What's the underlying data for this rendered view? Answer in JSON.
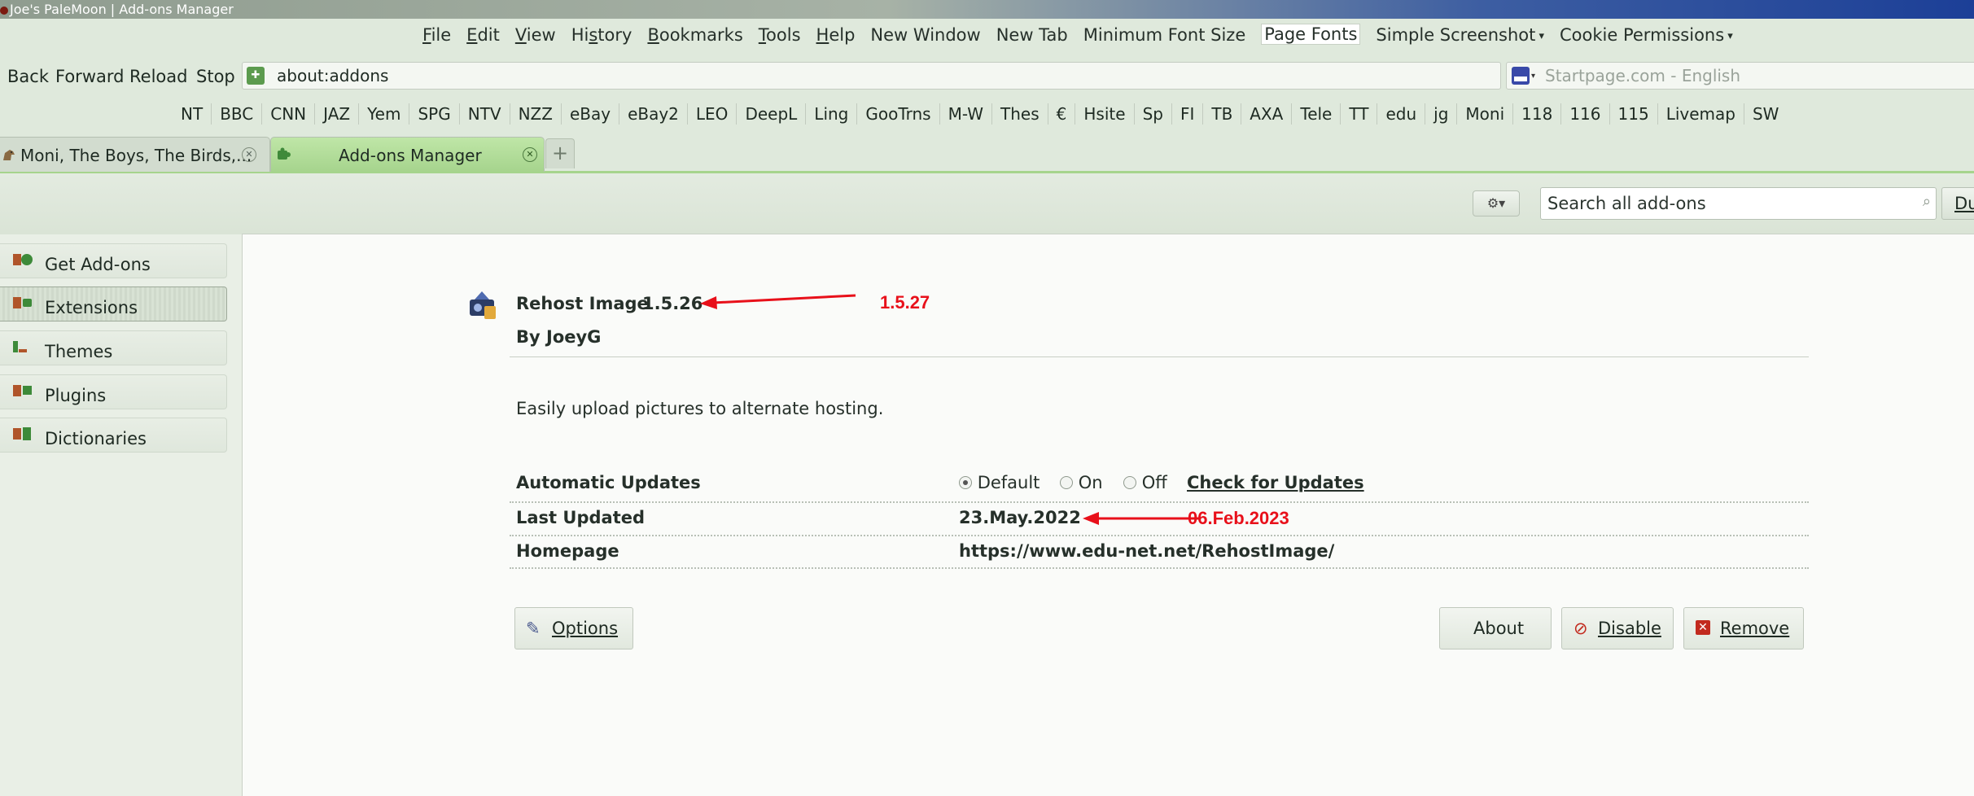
{
  "window": {
    "title": "Joe's PaleMoon | Add-ons Manager"
  },
  "menubar": {
    "items": [
      "File",
      "Edit",
      "View",
      "History",
      "Bookmarks",
      "Tools",
      "Help",
      "New Window",
      "New Tab",
      "Minimum Font Size",
      "Page Fonts",
      "Simple Screenshot",
      "Cookie Permissions"
    ]
  },
  "navbar": {
    "back": "Back",
    "forward": "Forward",
    "reload": "Reload",
    "stop": "Stop",
    "url": "about:addons",
    "search_placeholder": "Startpage.com - English"
  },
  "bookmarks": [
    "NT",
    "BBC",
    "CNN",
    "JAZ",
    "Yem",
    "SPG",
    "NTV",
    "NZZ",
    "eBay",
    "eBay2",
    "LEO",
    "DeepL",
    "Ling",
    "GooTrns",
    "M-W",
    "Thes",
    "€",
    "Hsite",
    "Sp",
    "FI",
    "TB",
    "AXA",
    "Tele",
    "TT",
    "edu",
    "jg",
    "Moni",
    "118",
    "116",
    "115",
    "Livemap",
    "SW"
  ],
  "tabs": [
    {
      "label": "Moni, The Boys, The Birds,..."
    },
    {
      "label": "Add-ons Manager"
    }
  ],
  "addons_toolbar": {
    "search_placeholder": "Search all add-ons",
    "cut_button": "Du"
  },
  "sidebar": {
    "items": [
      {
        "label": "Get Add-ons"
      },
      {
        "label": "Extensions"
      },
      {
        "label": "Themes"
      },
      {
        "label": "Plugins"
      },
      {
        "label": "Dictionaries"
      }
    ]
  },
  "detail": {
    "name": "Rehost Image",
    "version": "1.5.26",
    "author": "By JoeyG",
    "description": "Easily upload pictures to alternate hosting.",
    "auto_updates_label": "Automatic Updates",
    "radio_default": "Default",
    "radio_on": "On",
    "radio_off": "Off",
    "check_updates": "Check for Updates",
    "last_updated_label": "Last Updated",
    "last_updated_value": "23.May.2022",
    "homepage_label": "Homepage",
    "homepage_value": "https://www.edu-net.net/RehostImage/",
    "options_button": "Options",
    "about_button": "About",
    "disable_button": "Disable",
    "remove_button": "Remove"
  },
  "annotations": {
    "new_version": "1.5.27",
    "new_date": "06.Feb.2023",
    "color": "#e8101a"
  }
}
